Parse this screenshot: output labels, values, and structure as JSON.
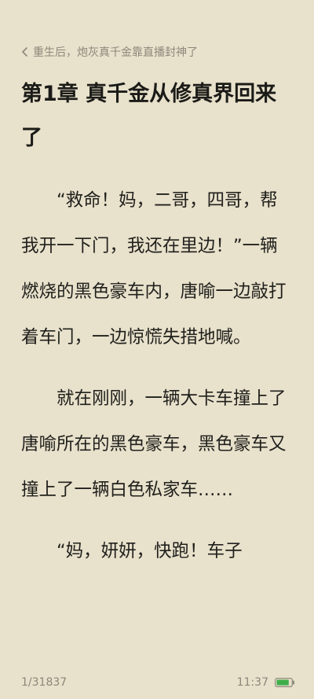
{
  "header": {
    "book_title": "重生后，炮灰真千金靠直播封神了"
  },
  "chapter": {
    "title": "第1章 真千金从修真界回来了"
  },
  "paragraphs": [
    "“救命！妈，二哥，四哥，帮我开一下门，我还在里边！”一辆燃烧的黑色豪车内，唐喻一边敲打着车门，一边惊慌失措地喊。",
    "就在刚刚，一辆大卡车撞上了唐喻所在的黑色豪车，黑色豪车又撞上了一辆白色私家车……",
    "“妈，妍妍，快跑！车子"
  ],
  "footer": {
    "progress": "1/31837",
    "time": "11:37",
    "battery_level": 0.85,
    "battery_color": "#3fae4a"
  },
  "icons": {
    "back": "chevron-left-icon",
    "battery": "battery-icon"
  }
}
